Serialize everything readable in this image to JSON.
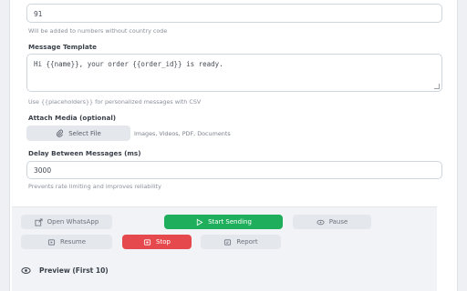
{
  "country_code": {
    "value": "91",
    "help": "Will be added to numbers without country code"
  },
  "message_template": {
    "label": "Message Template",
    "value": "Hi {{name}}, your order {{order_id}} is ready.",
    "help": "Use {{placeholders}} for personalized messages with CSV"
  },
  "attach_media": {
    "label": "Attach Media (optional)",
    "button_label": "Select File",
    "hint": "Images, Videos, PDF, Documents"
  },
  "delay": {
    "label": "Delay Between Messages (ms)",
    "value": "3000",
    "help": "Prevents rate limiting and improves reliability"
  },
  "actions": {
    "open_whatsapp": "Open WhatsApp",
    "start_sending": "Start Sending",
    "pause": "Pause",
    "resume": "Resume",
    "stop": "Stop",
    "report": "Report"
  },
  "preview": {
    "title": "Preview (First 10)"
  },
  "icons": {
    "open_whatsapp": "external-link-icon",
    "start_sending": "play-icon",
    "pause": "pause-icon",
    "resume": "resume-icon",
    "stop": "stop-icon",
    "report": "report-icon",
    "select_file": "paperclip-icon",
    "preview": "eye-icon"
  },
  "colors": {
    "start": "#1fae5b",
    "stop": "#e5484d",
    "muted_button": "#e4e7ec"
  }
}
